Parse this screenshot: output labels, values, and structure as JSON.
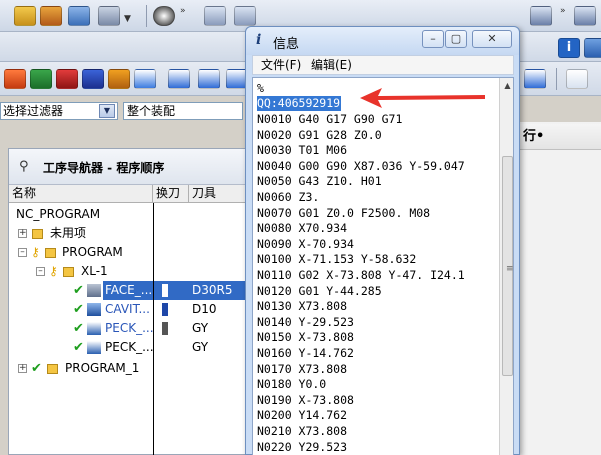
{
  "background_app": {
    "filter_label": "选择过滤器",
    "assembly_label": "整个装配",
    "right_column_header": "行•",
    "navigator": {
      "title": "工序导航器 - 程序顺序",
      "columns": [
        "名称",
        "换刀",
        "刀具"
      ],
      "rows": [
        {
          "name": "NC_PROGRAM",
          "tool": ""
        },
        {
          "name": "未用项",
          "tool": ""
        },
        {
          "name": "PROGRAM",
          "tool": ""
        },
        {
          "name": "XL-1",
          "tool": ""
        },
        {
          "name": "FACE_...",
          "tool": "D30R5"
        },
        {
          "name": "CAVIT...",
          "tool": "D10"
        },
        {
          "name": "PECK_...",
          "tool": "GY"
        },
        {
          "name": "PECK_...",
          "tool": "GY"
        },
        {
          "name": "PROGRAM_1",
          "tool": ""
        }
      ]
    }
  },
  "info_window": {
    "title": "信息",
    "title_icon": "i",
    "buttons": {
      "minimize": "–",
      "restore": "▢",
      "close": "✕"
    },
    "menu": {
      "file": "文件(F)",
      "edit": "编辑(E)"
    },
    "percent_line": "%",
    "qq_line": "QQ:406592919",
    "code_lines": [
      "N0010 G40 G17 G90 G71",
      "N0020 G91 G28 Z0.0",
      "N0030 T01 M06",
      "N0040 G00 G90 X87.036 Y-59.047",
      "N0050 G43 Z10. H01",
      "N0060 Z3.",
      "N0070 G01 Z0.0 F2500. M08",
      "N0080 X70.934",
      "N0090 X-70.934",
      "N0100 X-71.153 Y-58.632",
      "N0110 G02 X-73.808 Y-47. I24.1",
      "N0120 G01 Y-44.285",
      "N0130 X73.808",
      "N0140 Y-29.523",
      "N0150 X-73.808",
      "N0160 Y-14.762",
      "N0170 X73.808",
      "N0180 Y0.0",
      "N0190 X-73.808",
      "N0200 Y14.762",
      "N0210 X73.808",
      "N0220 Y29.523"
    ]
  },
  "colors": {
    "selection": "#316ac5",
    "qq_highlight": "#3478d4",
    "annotation_arrow": "#e8332b",
    "check_green": "#1e9e1e"
  }
}
